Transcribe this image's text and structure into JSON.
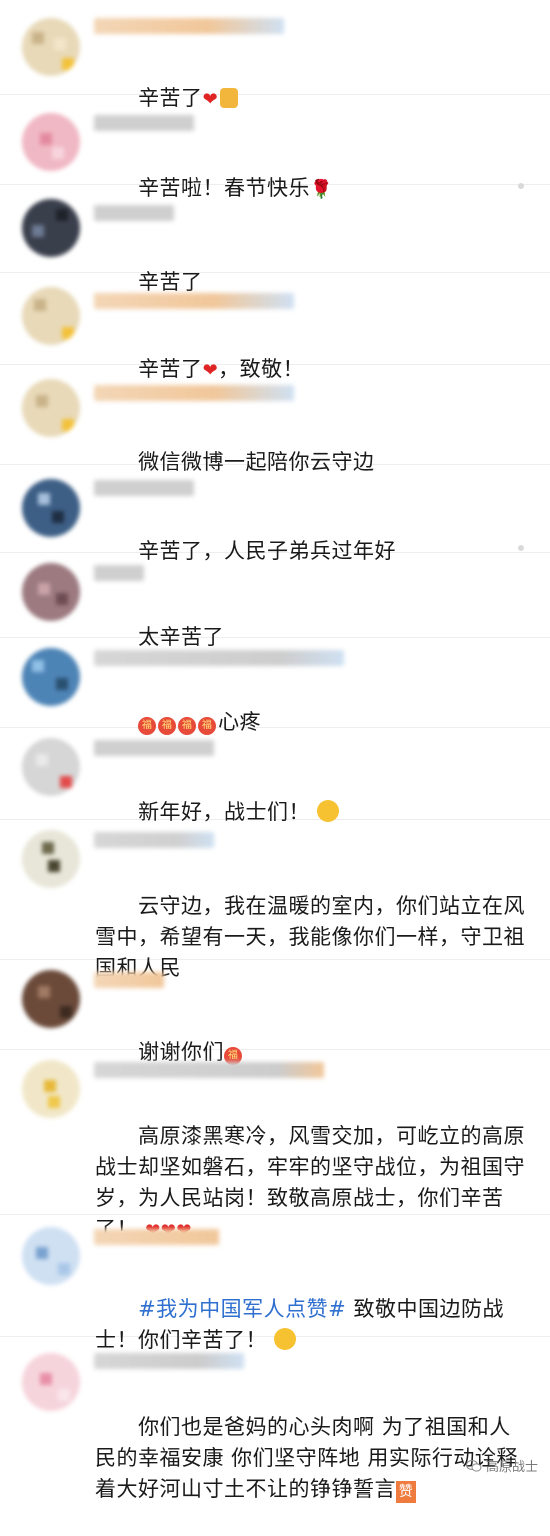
{
  "comments": [
    {
      "text": "辛苦了",
      "emoji": "❤"
    },
    {
      "text": "辛苦啦！春节快乐",
      "emoji": "🌹"
    },
    {
      "text": "辛苦了"
    },
    {
      "text_before": "辛苦了",
      "emoji": "❤",
      "text_after": "，致敬！"
    },
    {
      "text": "微信微博一起陪你云守边"
    },
    {
      "text": "辛苦了，人民子弟兵过年好"
    },
    {
      "text": "太辛苦了"
    },
    {
      "badge": "福",
      "text": "心疼"
    },
    {
      "text": "新年好，战士们！"
    },
    {
      "text": "云守边，我在温暖的室内，你们站立在风雪中，希望有一天，我能像你们一样，守卫祖国和人民"
    },
    {
      "text": "谢谢你们",
      "badge": "福"
    },
    {
      "text": "高原漆黑寒冷，风雪交加，可屹立的高原战士却坚如磐石，牢牢的坚守战位，为祖国守岁，为人民站岗！致敬高原战士，你们辛苦了！",
      "emoji": "❤❤❤"
    },
    {
      "hashtag": "#我为中国军人点赞#",
      "text": " 致敬中国边防战士！你们辛苦了！"
    },
    {
      "text": "你们也是爸妈的心头肉啊 为了祖国和人民的幸福安康 你们坚守阵地 用实际行动诠释着大好河山寸土不让的铮铮誓言",
      "badge": "赞"
    }
  ],
  "watermark": {
    "label": "高原战士"
  },
  "colors": {
    "hashtag": "#2e6fcf",
    "heart": "#e02424",
    "divider": "#eeeeee"
  }
}
